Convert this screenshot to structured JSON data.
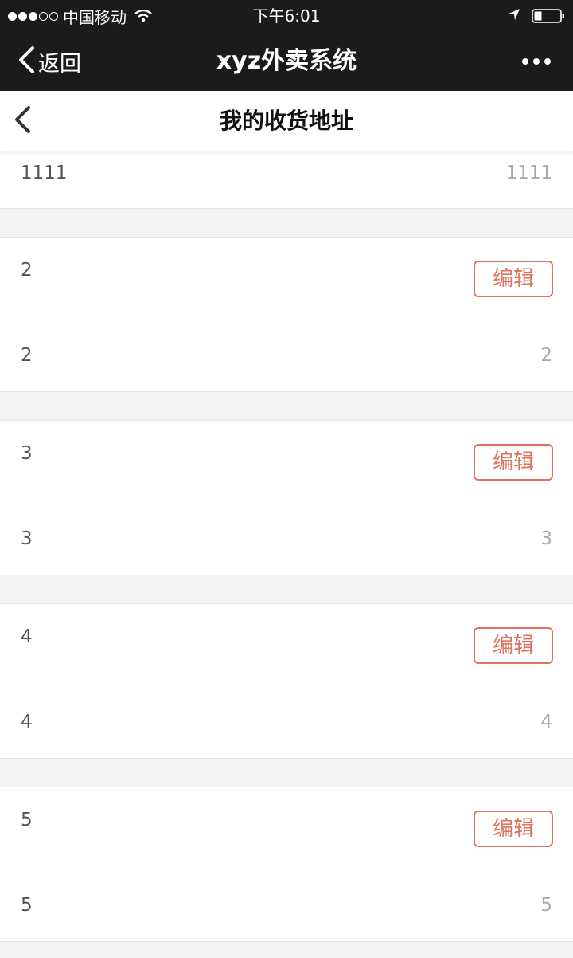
{
  "status_bar": {
    "carrier": "中国移动",
    "time": "下午6:01"
  },
  "wechat_nav": {
    "back_label": "返回",
    "title": "xyz外卖系统"
  },
  "header": {
    "title": "我的收货地址"
  },
  "first_entry": {
    "name": "1111",
    "value": "1111"
  },
  "addresses": [
    {
      "name": "2",
      "edit_label": "编辑",
      "detail": "2",
      "detail_value": "2"
    },
    {
      "name": "3",
      "edit_label": "编辑",
      "detail": "3",
      "detail_value": "3"
    },
    {
      "name": "4",
      "edit_label": "编辑",
      "detail": "4",
      "detail_value": "4"
    },
    {
      "name": "5",
      "edit_label": "编辑",
      "detail": "5",
      "detail_value": "5"
    }
  ],
  "colors": {
    "accent": "#e0735e",
    "nav_background": "#1b1b1b",
    "page_background": "#f3f3f3"
  }
}
